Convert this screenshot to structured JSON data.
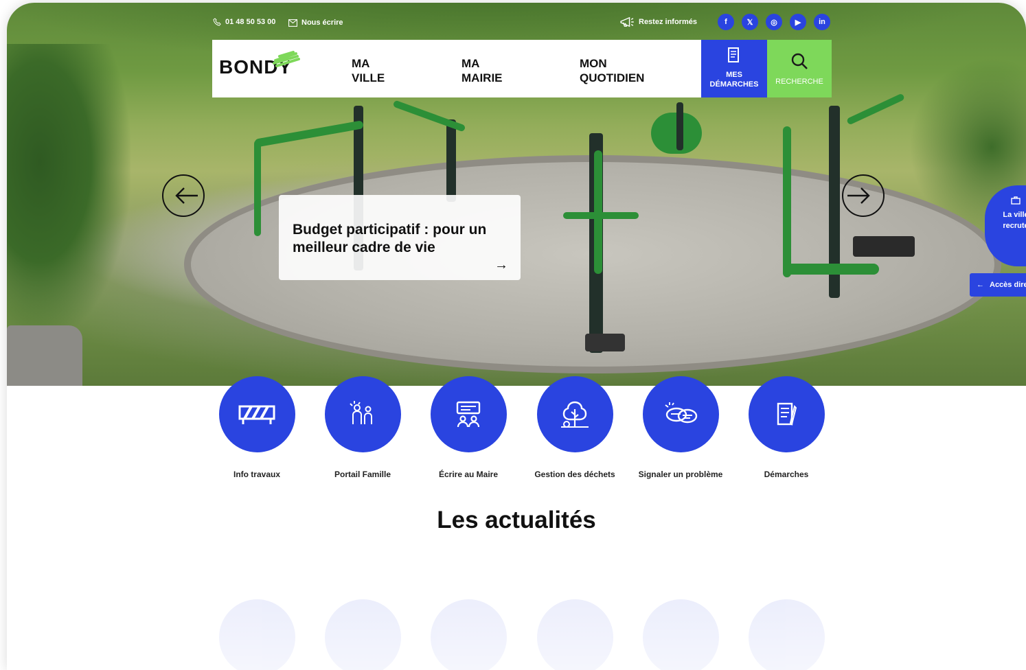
{
  "topbar": {
    "phone": "01 48 50 53 00",
    "email_label": "Nous écrire",
    "newsletter_label": "Restez informés",
    "social": [
      {
        "icon": "facebook-icon",
        "glyph": "f"
      },
      {
        "icon": "x-icon",
        "glyph": "𝕏"
      },
      {
        "icon": "instagram-icon",
        "glyph": "◎"
      },
      {
        "icon": "youtube-icon",
        "glyph": "▶"
      },
      {
        "icon": "linkedin-icon",
        "glyph": "in"
      }
    ]
  },
  "header": {
    "logo": "BONDY",
    "nav": [
      {
        "line1": "MA",
        "line2": "VILLE"
      },
      {
        "line1": "MA",
        "line2": "MAIRIE"
      },
      {
        "line1": "MON",
        "line2": "QUOTIDIEN"
      }
    ],
    "demarches_line1": "MES",
    "demarches_line2": "DÉMARCHES",
    "search_label": "RECHERCHE"
  },
  "hero": {
    "slide_title": "Budget participatif : pour un meilleur cadre de vie",
    "slide_arrow": "→"
  },
  "side": {
    "recrute_line1": "La ville",
    "recrute_line2": "recrute",
    "acces": "Accès direct",
    "acces_arrow": "←"
  },
  "quick_links": [
    {
      "label": "Info travaux",
      "icon": "barrier-icon"
    },
    {
      "label": "Portail Famille",
      "icon": "family-icon"
    },
    {
      "label": "Écrire au Maire",
      "icon": "meeting-icon"
    },
    {
      "label": "Gestion des déchets",
      "icon": "tree-recycle-icon"
    },
    {
      "label": "Signaler un problème",
      "icon": "speech-bubbles-icon"
    },
    {
      "label": "Démarches",
      "icon": "document-icon"
    }
  ],
  "section": {
    "title_part1": "Les",
    "title_part2": "actualités"
  },
  "colors": {
    "brand_blue": "#2a44e0",
    "brand_green": "#7ed85a"
  }
}
